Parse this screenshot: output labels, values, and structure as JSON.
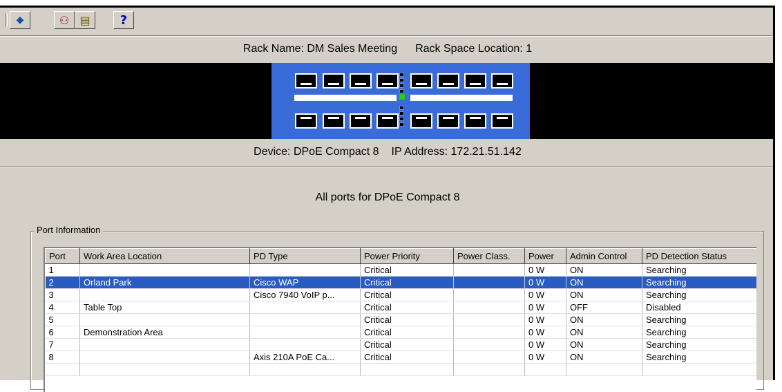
{
  "toolbar": {
    "buttons": [
      {
        "name": "diamond-icon",
        "glyph": "◆"
      },
      {
        "name": "users-icon",
        "glyph": "⚇"
      },
      {
        "name": "document-icon",
        "glyph": "▤"
      },
      {
        "name": "help-icon",
        "glyph": "?"
      }
    ]
  },
  "rack": {
    "name_text": "Rack Name: DM Sales Meeting",
    "location_text": "Rack Space Location: 1"
  },
  "device": {
    "name_text": "Device: DPoE Compact 8",
    "ip_text": "IP Address: 172.21.51.142"
  },
  "all_ports_title": "All ports for DPoE Compact 8",
  "port_info": {
    "group_label": "Port Information",
    "columns": [
      "Port",
      "Work Area Location",
      "PD Type",
      "Power Priority",
      "Power Class.",
      "Power",
      "Admin Control",
      "PD Detection Status"
    ],
    "rows": [
      {
        "port": "1",
        "location": "",
        "pd_type": "",
        "priority": "Critical",
        "power_class": "",
        "power": "0 W",
        "admin": "ON",
        "status": "Searching",
        "selected": false
      },
      {
        "port": "2",
        "location": "Orland Park",
        "pd_type": "Cisco WAP",
        "priority": "Critical",
        "power_class": "",
        "power": "0 W",
        "admin": "ON",
        "status": "Searching",
        "selected": true
      },
      {
        "port": "3",
        "location": "",
        "pd_type": "Cisco 7940 VoIP p...",
        "priority": "Critical",
        "power_class": "",
        "power": "0 W",
        "admin": "ON",
        "status": "Searching",
        "selected": false
      },
      {
        "port": "4",
        "location": "Table Top",
        "pd_type": "",
        "priority": "Critical",
        "power_class": "",
        "power": "0 W",
        "admin": "OFF",
        "status": "Disabled",
        "selected": false
      },
      {
        "port": "5",
        "location": "",
        "pd_type": "",
        "priority": "Critical",
        "power_class": "",
        "power": "0 W",
        "admin": "ON",
        "status": "Searching",
        "selected": false
      },
      {
        "port": "6",
        "location": "Demonstration Area",
        "pd_type": "",
        "priority": "Critical",
        "power_class": "",
        "power": "0 W",
        "admin": "ON",
        "status": "Searching",
        "selected": false
      },
      {
        "port": "7",
        "location": "",
        "pd_type": "",
        "priority": "Critical",
        "power_class": "",
        "power": "0 W",
        "admin": "ON",
        "status": "Searching",
        "selected": false
      },
      {
        "port": "8",
        "location": "",
        "pd_type": "Axis 210A PoE Ca...",
        "priority": "Critical",
        "power_class": "",
        "power": "0 W",
        "admin": "ON",
        "status": "Searching",
        "selected": false
      }
    ]
  },
  "colors": {
    "window_bg": "#d4d0c8",
    "device_blue": "#3a6cd9",
    "selection": "#2a5cbf",
    "link_led": "#22cc22"
  }
}
